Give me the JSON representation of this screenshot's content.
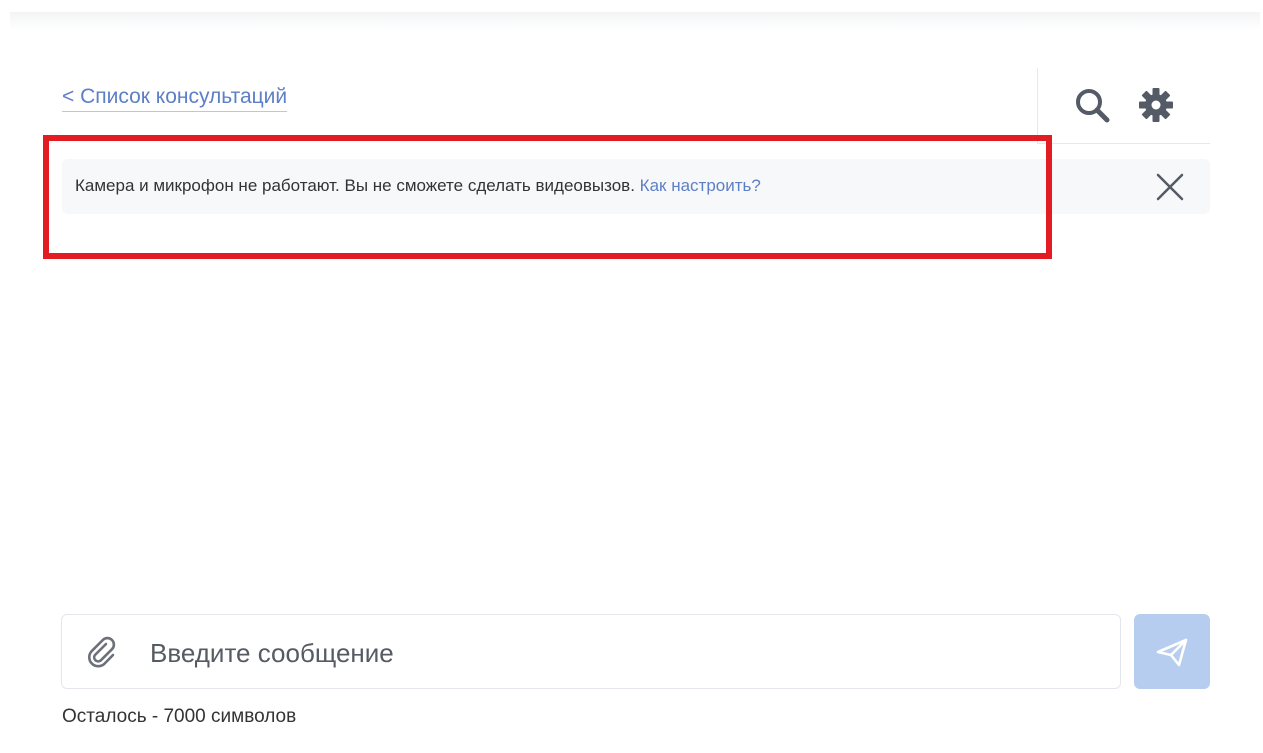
{
  "header": {
    "back_link_label": "< Список консультаций",
    "search_icon": "search-icon",
    "settings_icon": "gear-icon"
  },
  "notice": {
    "message": "Камера и микрофон не работают. Вы не сможете сделать видеовызов.",
    "link_label": "Как настроить?",
    "close_icon": "close-icon"
  },
  "composer": {
    "placeholder": "Введите сообщение",
    "value": "",
    "attach_icon": "paperclip-icon",
    "send_icon": "send-icon",
    "counter_text": "Осталось - 7000 символов"
  },
  "colors": {
    "accent": "#5d7fc7",
    "send_button_disabled": "#b7cdf0",
    "highlight": "#e31b23"
  }
}
